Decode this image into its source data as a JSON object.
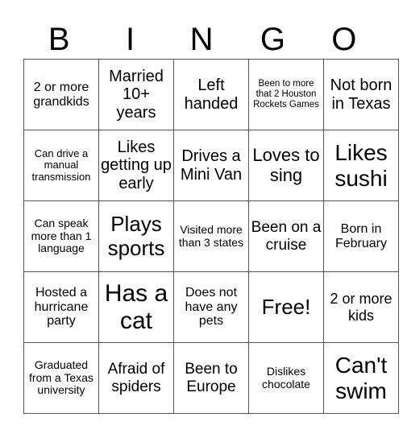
{
  "header": {
    "letters": [
      "B",
      "I",
      "N",
      "G",
      "O"
    ]
  },
  "board": {
    "rows": [
      [
        "2 or more grandkids",
        "Married 10+ years",
        "Left handed",
        "Been to more that 2 Houston Rockets Games",
        "Not born in Texas"
      ],
      [
        "Can drive a manual transmission",
        "Likes getting up early",
        "Drives a Mini Van",
        "Loves to sing",
        "Likes sushi"
      ],
      [
        "Can speak more than 1 language",
        "Plays sports",
        "Visited more than 3 states",
        "Been on a cruise",
        "Born in February"
      ],
      [
        "Hosted a hurricane party",
        "Has a cat",
        "Does not have any pets",
        "Free!",
        "2 or more kids"
      ],
      [
        "Graduated from a Texas university",
        "Afraid of spiders",
        "Been to Europe",
        "Dislikes chocolate",
        "Can't swim"
      ]
    ]
  }
}
